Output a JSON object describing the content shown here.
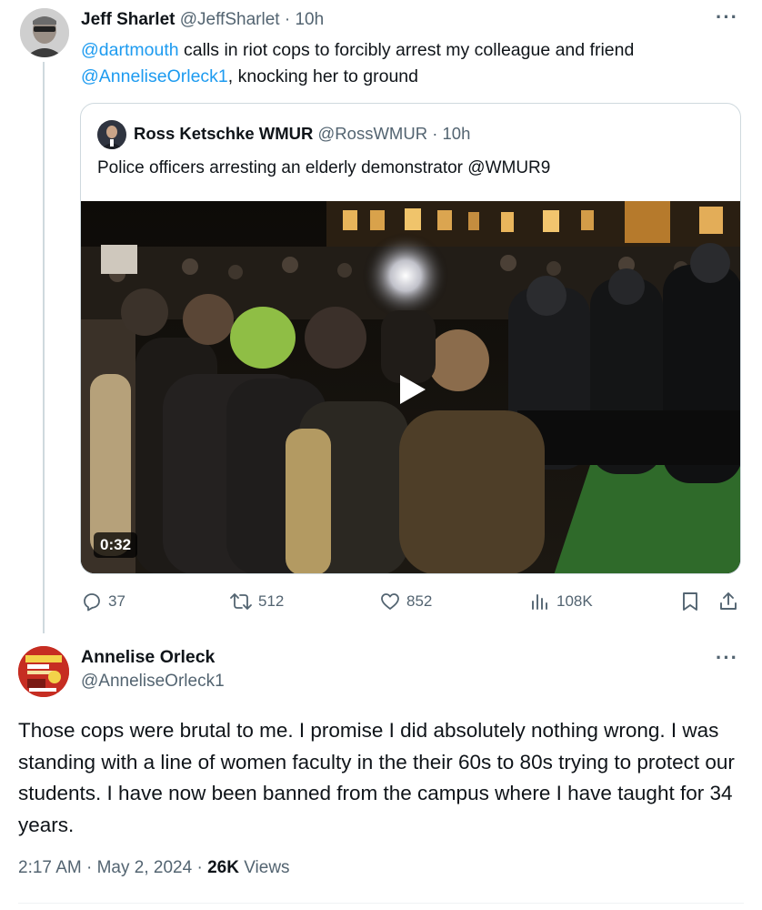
{
  "tweet": {
    "author_name": "Jeff Sharlet",
    "author_handle": "@JeffSharlet",
    "time": "10h",
    "text_mention_1": "@dartmouth",
    "text_part_1": " calls in riot cops to forcibly arrest my colleague and friend ",
    "text_mention_2": "@AnneliseOrleck1",
    "text_part_2": ", knocking her to ground",
    "more_label": "···"
  },
  "quote": {
    "author_name": "Ross Ketschke WMUR",
    "author_handle": "@RossWMUR",
    "time": "10h",
    "text": "Police officers arresting an elderly demonstrator @WMUR9",
    "video_duration": "0:32"
  },
  "actions": {
    "replies": "37",
    "retweets": "512",
    "likes": "852",
    "views": "108K"
  },
  "reply": {
    "author_name": "Annelise Orleck",
    "author_handle": "@AnneliseOrleck1",
    "more_label": "···",
    "text": "Those cops were brutal to me. I promise I did absolutely nothing wrong.  I was standing with a line of women faculty in the their 60s to 80s trying to protect our students. I have now been banned from the campus where I have taught for 34 years.",
    "time": "2:17 AM",
    "date": "May 2, 2024",
    "views_count": "26K",
    "views_label": "Views"
  },
  "colors": {
    "link": "#1d9bf0",
    "muted": "#536471",
    "border": "#cfd9de"
  }
}
